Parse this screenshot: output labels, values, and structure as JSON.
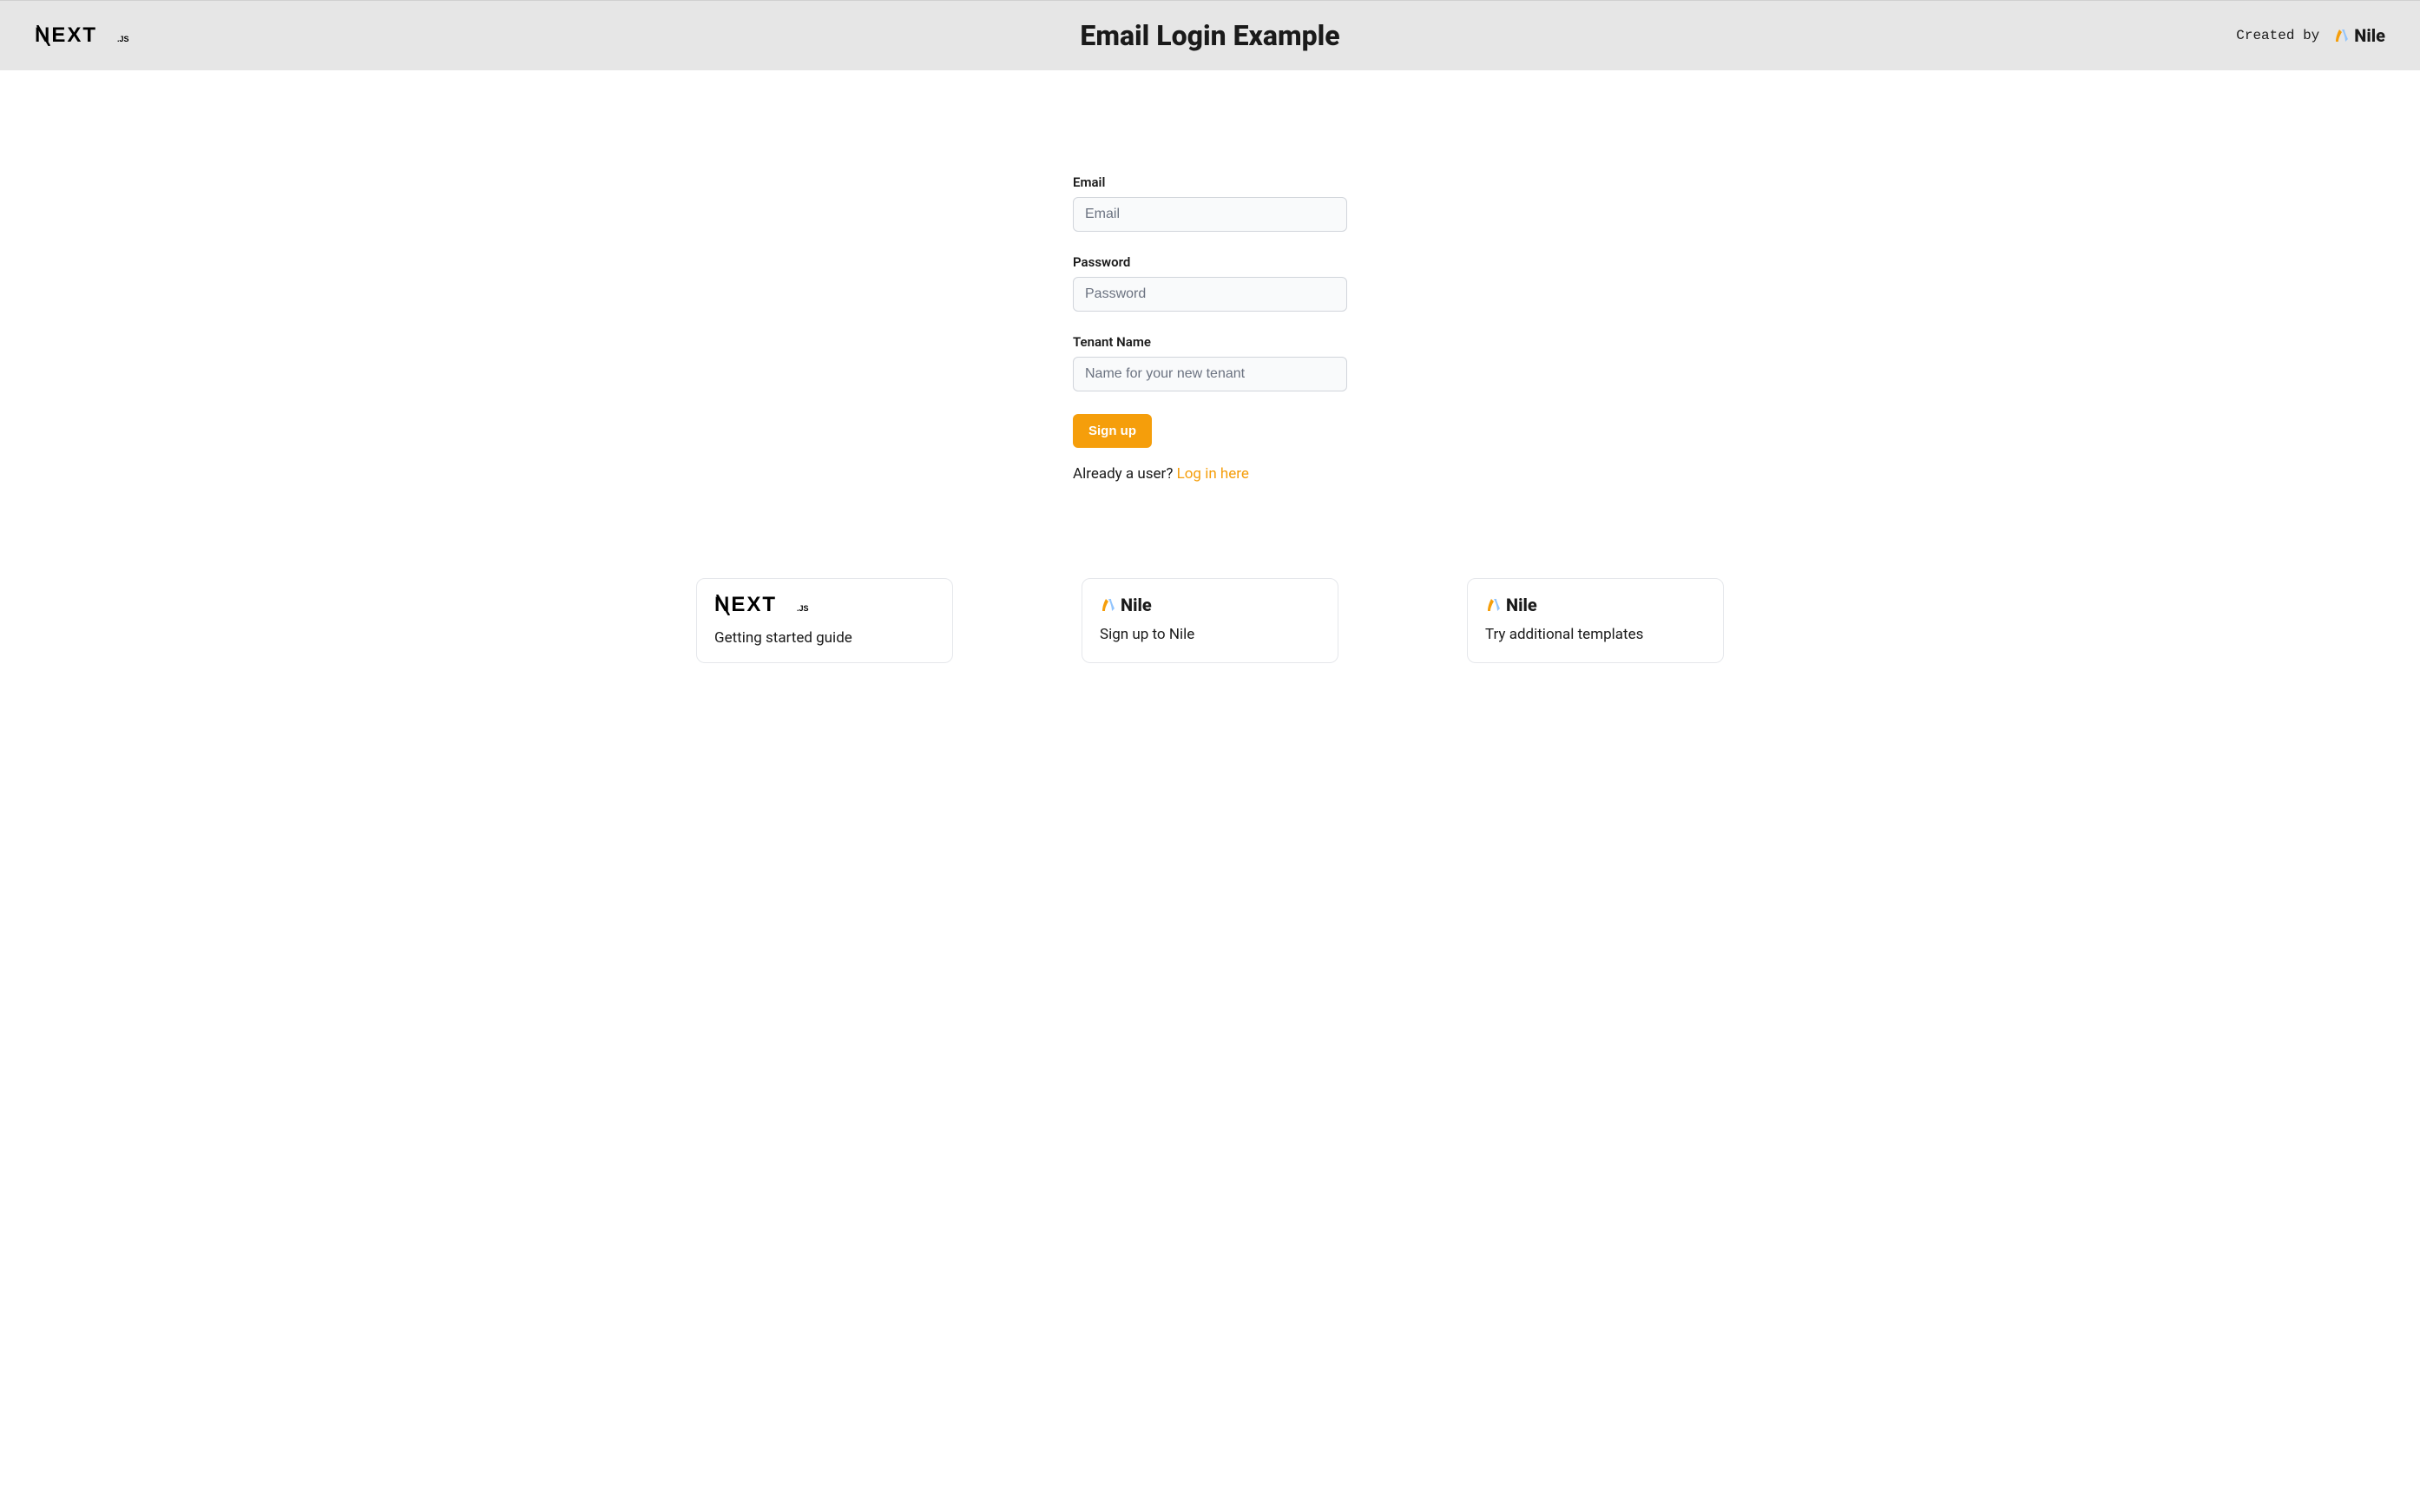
{
  "header": {
    "title": "Email Login Example",
    "created_by": "Created by",
    "nile_brand": "Nile"
  },
  "form": {
    "email": {
      "label": "Email",
      "placeholder": "Email",
      "value": ""
    },
    "password": {
      "label": "Password",
      "placeholder": "Password",
      "value": ""
    },
    "tenant": {
      "label": "Tenant Name",
      "placeholder": "Name for your new tenant",
      "value": ""
    },
    "submit_label": "Sign up",
    "login_prompt": "Already a user? ",
    "login_link": "Log in here"
  },
  "cards": [
    {
      "logo": "nextjs",
      "text": "Getting started guide"
    },
    {
      "logo": "nile",
      "text": "Sign up to Nile"
    },
    {
      "logo": "nile",
      "text": "Try additional templates"
    }
  ]
}
